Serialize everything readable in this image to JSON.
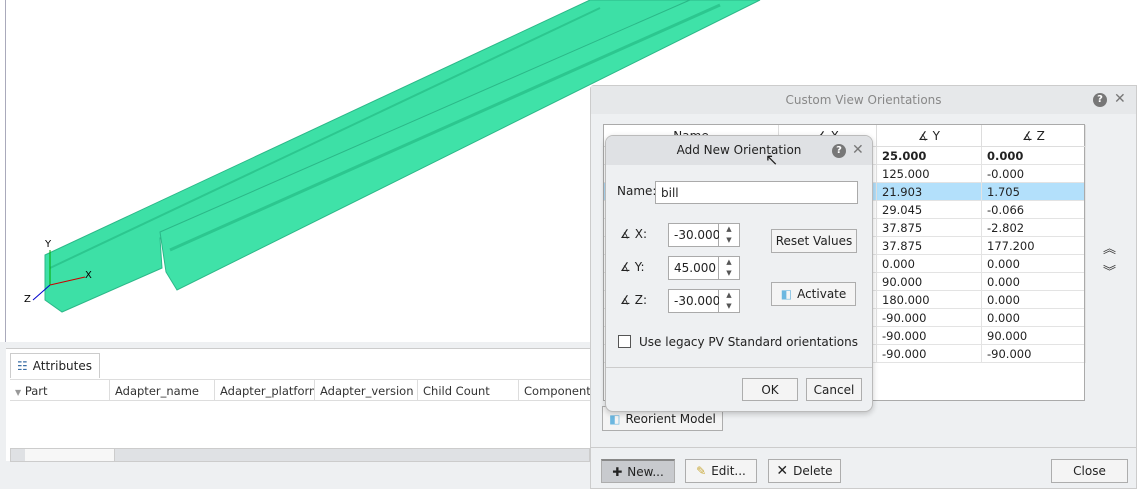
{
  "viewport": {
    "model_color": "#3de0a6",
    "axes": {
      "x": "X",
      "y": "Y",
      "z": "Z"
    }
  },
  "attributes_panel": {
    "tab_label": "Attributes",
    "columns": [
      "Part",
      "Adapter_name",
      "Adapter_platform",
      "Adapter_version",
      "Child Count",
      "Component"
    ]
  },
  "main_dialog": {
    "title": "Custom View Orientations",
    "columns": [
      "Name",
      "X",
      "Y",
      "Z"
    ],
    "rows": [
      [
        "25.000",
        "0.000"
      ],
      [
        "125.000",
        "-0.000"
      ],
      [
        "21.903",
        "1.705"
      ],
      [
        "29.045",
        "-0.066"
      ],
      [
        "37.875",
        "-2.802"
      ],
      [
        "37.875",
        "177.200"
      ],
      [
        "0.000",
        "0.000"
      ],
      [
        "90.000",
        "0.000"
      ],
      [
        "180.000",
        "0.000"
      ],
      [
        "-90.000",
        "0.000"
      ],
      [
        "-90.000",
        "90.000"
      ],
      [
        "-90.000",
        "-90.000"
      ]
    ],
    "selected_row": 2,
    "reorient_label": "Reorient Model",
    "new_label": "New...",
    "edit_label": "Edit...",
    "delete_label": "Delete",
    "close_label": "Close"
  },
  "add_dialog": {
    "title": "Add New Orientation",
    "name_label": "Name:",
    "name_value": "bill",
    "x_label": "X:",
    "x_value": "-30.000",
    "y_label": "Y:",
    "y_value": "45.000",
    "z_label": "Z:",
    "z_value": "-30.000",
    "reset_label": "Reset Values",
    "activate_label": "Activate",
    "legacy_label": "Use legacy PV Standard orientations",
    "legacy_checked": false,
    "ok_label": "OK",
    "cancel_label": "Cancel"
  }
}
